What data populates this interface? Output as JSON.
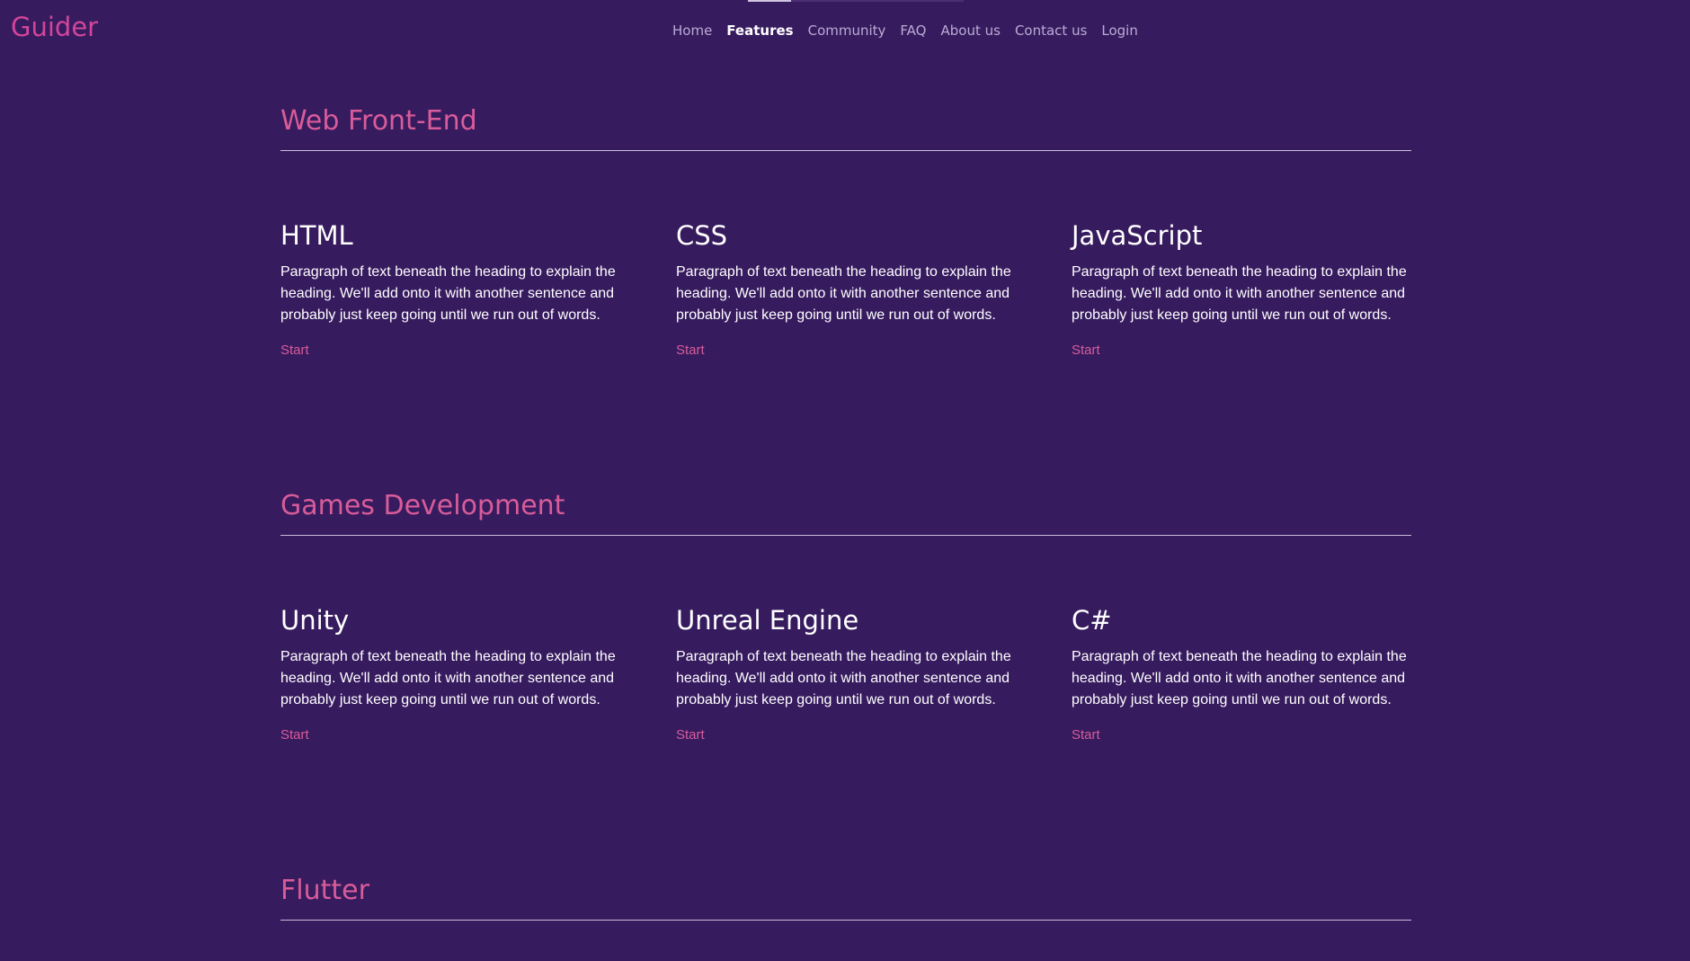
{
  "site": {
    "logo": "Guider"
  },
  "nav": {
    "items": [
      {
        "label": "Home"
      },
      {
        "label": "Features"
      },
      {
        "label": "Community"
      },
      {
        "label": "FAQ"
      },
      {
        "label": "About us"
      },
      {
        "label": "Contact us"
      },
      {
        "label": "Login"
      }
    ],
    "active": "Features"
  },
  "sections": [
    {
      "title": "Web Front-End",
      "cards": [
        {
          "title": "HTML",
          "text": "Paragraph of text beneath the heading to explain the heading. We'll add onto it with another sentence and probably just keep going until we run out of words.",
          "link": "Start"
        },
        {
          "title": "CSS",
          "text": "Paragraph of text beneath the heading to explain the heading. We'll add onto it with another sentence and probably just keep going until we run out of words.",
          "link": "Start"
        },
        {
          "title": "JavaScript",
          "text": "Paragraph of text beneath the heading to explain the heading. We'll add onto it with another sentence and probably just keep going until we run out of words.",
          "link": "Start"
        }
      ]
    },
    {
      "title": "Games Development",
      "cards": [
        {
          "title": "Unity",
          "text": "Paragraph of text beneath the heading to explain the heading. We'll add onto it with another sentence and probably just keep going until we run out of words.",
          "link": "Start"
        },
        {
          "title": "Unreal Engine",
          "text": "Paragraph of text beneath the heading to explain the heading. We'll add onto it with another sentence and probably just keep going until we run out of words.",
          "link": "Start"
        },
        {
          "title": "C#",
          "text": "Paragraph of text beneath the heading to explain the heading. We'll add onto it with another sentence and probably just keep going until we run out of words.",
          "link": "Start"
        }
      ]
    },
    {
      "title": "Flutter",
      "cards": []
    }
  ],
  "colors": {
    "background": "#371b5f",
    "accent": "#d85c99",
    "logo": "#d2459a",
    "text": "#ffffff",
    "nav_text": "#b9acd4"
  }
}
